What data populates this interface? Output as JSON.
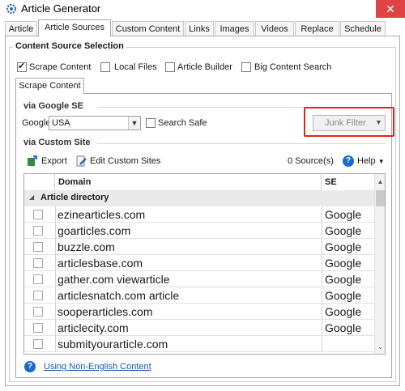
{
  "window": {
    "title": "Article Generator",
    "close_glyph": "✕"
  },
  "tabs": [
    "Article",
    "Article Sources",
    "Custom Content",
    "Links",
    "Images",
    "Videos",
    "Replace",
    "Schedule"
  ],
  "active_tab": "Article Sources",
  "content_source": {
    "group_title": "Content Source Selection",
    "options": [
      {
        "label": "Scrape Content",
        "checked": true
      },
      {
        "label": "Local Files",
        "checked": false
      },
      {
        "label": "Article Builder",
        "checked": false
      },
      {
        "label": "Big Content Search",
        "checked": false
      }
    ]
  },
  "inner_tab": "Scrape Content",
  "google_se": {
    "section_title": "via Google SE",
    "google_label": "Google",
    "country_value": "USA",
    "search_safe_label": "Search Safe",
    "search_safe_checked": false,
    "junk_filter_label": "Junk Filter"
  },
  "custom_site": {
    "section_title": "via Custom Site",
    "export_label": "Export",
    "edit_label": "Edit Custom Sites",
    "source_count": "0 Source(s)",
    "help_label": "Help",
    "columns": {
      "domain": "Domain",
      "se": "SE"
    },
    "group_name": "Article directory",
    "rows": [
      {
        "domain": "ezinearticles.com",
        "se": "Google"
      },
      {
        "domain": "goarticles.com",
        "se": "Google"
      },
      {
        "domain": "buzzle.com",
        "se": "Google"
      },
      {
        "domain": "articlesbase.com",
        "se": "Google"
      },
      {
        "domain": "gather.com viewarticle",
        "se": "Google"
      },
      {
        "domain": "articlesnatch.com article",
        "se": "Google"
      },
      {
        "domain": "sooperarticles.com",
        "se": "Google"
      },
      {
        "domain": "articlecity.com",
        "se": "Google"
      },
      {
        "domain": "submityourarticle.com",
        "se": ""
      }
    ]
  },
  "footer_link": "Using Non-English Content",
  "colors": {
    "accent_blue": "#1b6ac9",
    "highlight_red": "#e3241b",
    "close_red": "#e04343",
    "link_blue": "#1f56b3"
  },
  "icons": [
    "app-gear-icon",
    "close-icon",
    "export-icon",
    "edit-icon",
    "help-icon",
    "chevron-down-icon"
  ]
}
